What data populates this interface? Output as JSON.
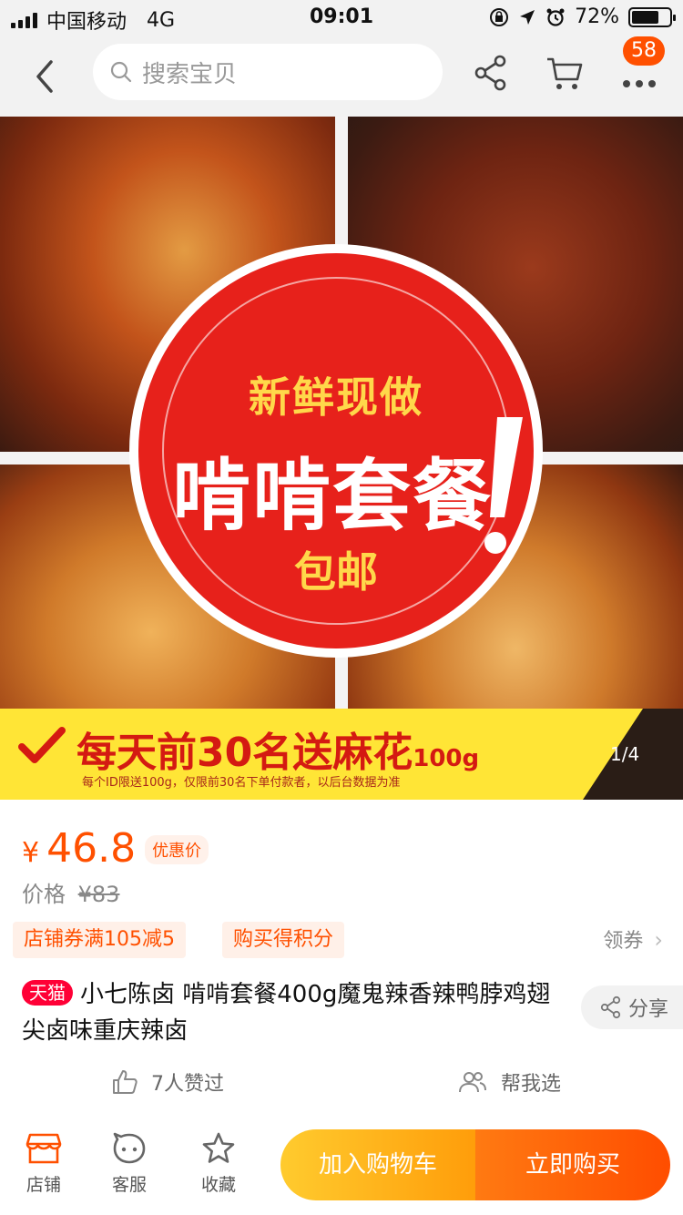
{
  "status_bar": {
    "carrier": "中国移动",
    "network": "4G",
    "time": "09:01",
    "battery": "72%",
    "battery_level": 0.72
  },
  "nav": {
    "search_placeholder": "搜索宝贝",
    "more_badge": "58"
  },
  "gallery": {
    "promo_line1": "新鲜现做",
    "promo_line2": "啃啃套餐",
    "promo_line3": "包邮",
    "banner_main": "每天前30名送麻花",
    "banner_main_small": "100g",
    "banner_sub": "每个ID限送100g，仅限前30名下单付款者，以后台数据为准",
    "page_indicator": "1/4"
  },
  "price": {
    "currency": "¥",
    "amount": "46.8",
    "tag": "优惠价",
    "original_label": "价格",
    "original_value": "¥83"
  },
  "coupons": {
    "items": [
      "店铺券满105减5",
      "购买得积分"
    ],
    "more_label": "领券"
  },
  "product": {
    "platform_tag": "天猫",
    "title": "小七陈卤 啃啃套餐400g魔鬼辣香辣鸭脖鸡翅尖卤味重庆辣卤",
    "share_label": "分享",
    "likes": "7人赞过",
    "help_choose": "帮我选"
  },
  "bottom_bar": {
    "shop": "店铺",
    "service": "客服",
    "favorite": "收藏",
    "add_to_cart": "加入购物车",
    "buy_now": "立即购买"
  },
  "colors": {
    "accent": "#ff5000",
    "tmall": "#ff0036",
    "promo_red": "#e7211b",
    "promo_yellow": "#ffe536"
  },
  "icons": [
    "back-icon",
    "search-icon",
    "share-icon",
    "cart-icon",
    "more-icon",
    "check-icon",
    "thumbs-up-icon",
    "people-icon",
    "shop-icon",
    "service-icon",
    "star-icon"
  ]
}
